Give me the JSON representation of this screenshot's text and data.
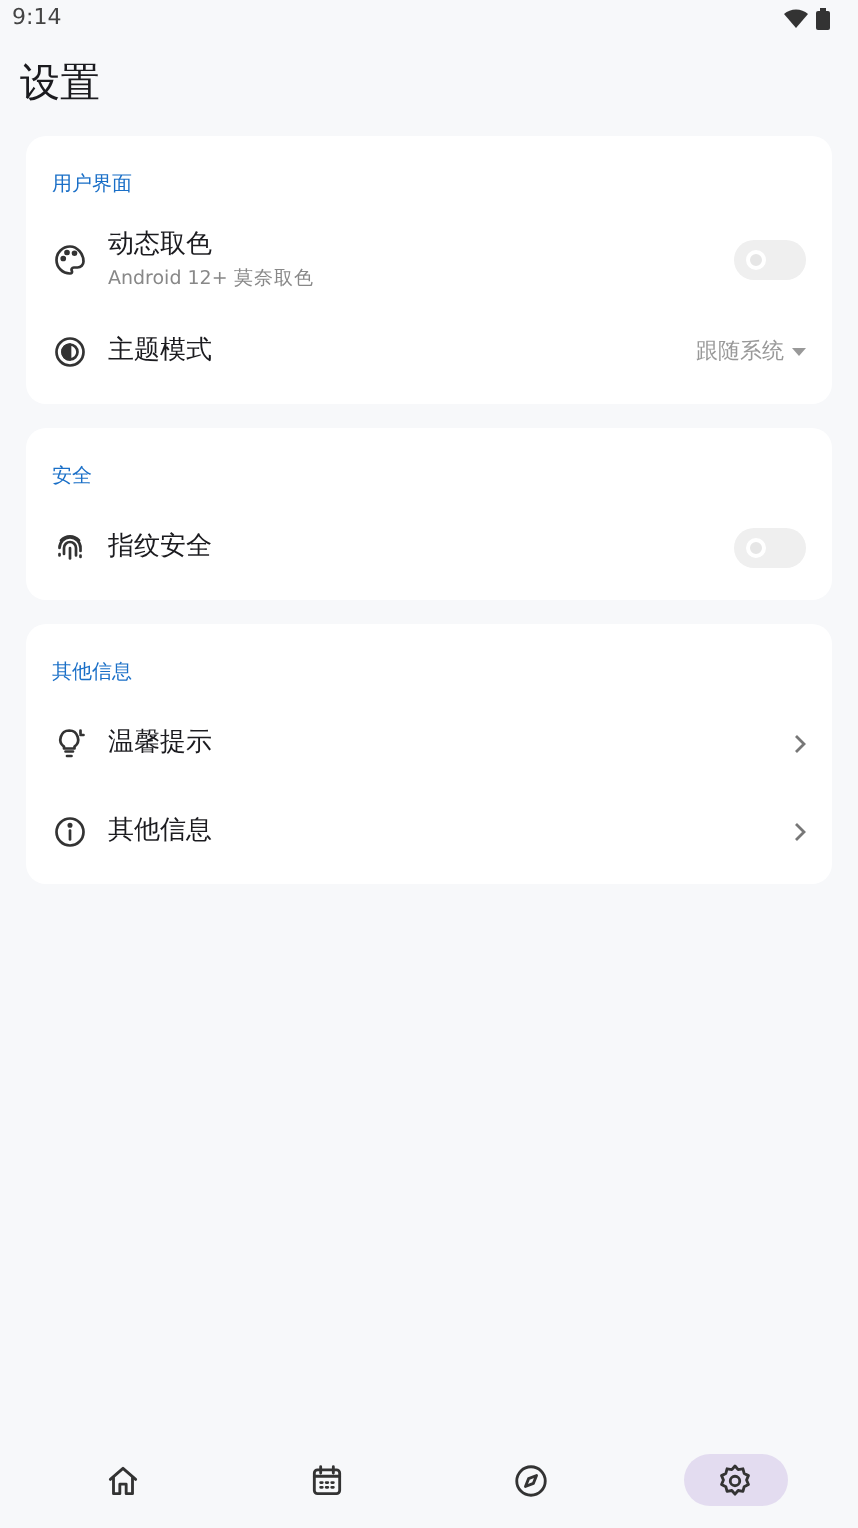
{
  "status_bar": {
    "time": "9:14"
  },
  "title": "设置",
  "sections": [
    {
      "header": "用户界面",
      "items": [
        {
          "kind": "switch",
          "label": "动态取色",
          "subtitle": "Android 12+ 莫奈取色",
          "on": false,
          "disabled": true
        },
        {
          "kind": "select",
          "label": "主题模式",
          "value": "跟随系统"
        }
      ]
    },
    {
      "header": "安全",
      "items": [
        {
          "kind": "switch",
          "label": "指纹安全",
          "on": false,
          "disabled": true
        }
      ]
    },
    {
      "header": "其他信息",
      "items": [
        {
          "kind": "link",
          "label": "温馨提示"
        },
        {
          "kind": "link",
          "label": "其他信息"
        }
      ]
    }
  ],
  "nav": [
    {
      "selected": false
    },
    {
      "selected": false
    },
    {
      "selected": false
    },
    {
      "selected": true
    }
  ]
}
